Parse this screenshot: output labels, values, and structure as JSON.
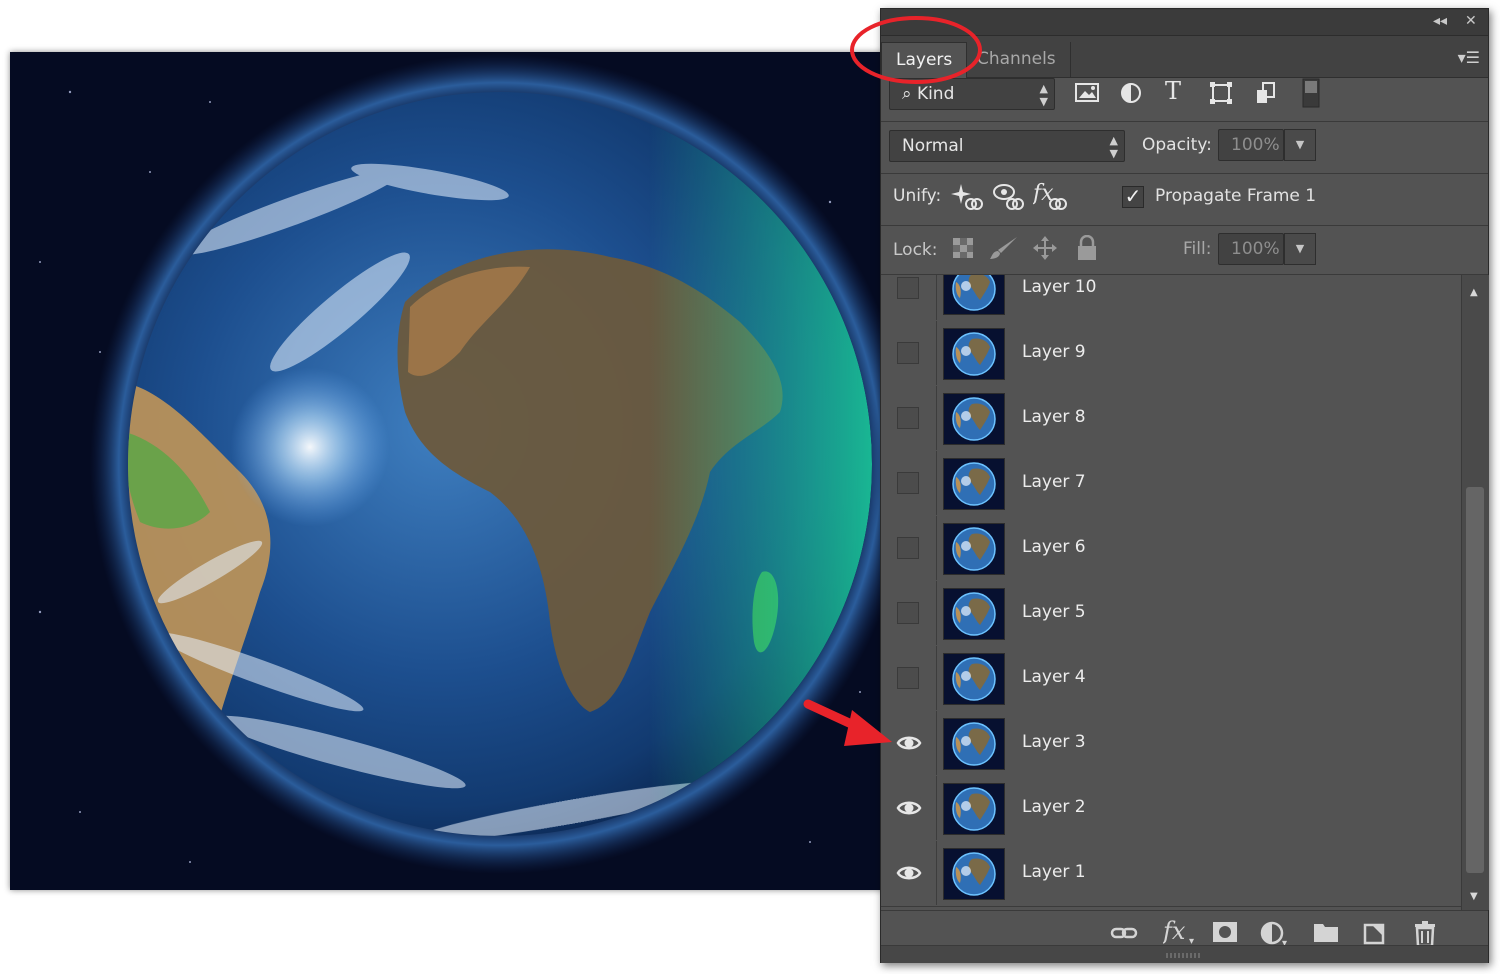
{
  "panel": {
    "tabs": [
      {
        "label": "Layers",
        "active": true
      },
      {
        "label": "Channels",
        "active": false
      }
    ],
    "collapse_icon": "double-chevron-left-icon",
    "close_icon": "close-icon",
    "menu_icon": "panel-menu-icon"
  },
  "filter": {
    "kind_label": "Kind",
    "filter_icons": [
      "image-filter-icon",
      "adjustment-filter-icon",
      "type-filter-icon",
      "shape-filter-icon",
      "smart-object-filter-icon"
    ]
  },
  "blend": {
    "mode": "Normal",
    "opacity_label": "Opacity:",
    "opacity_value": "100%"
  },
  "unify": {
    "label": "Unify:",
    "propagate_label": "Propagate Frame 1",
    "propagate_checked": true
  },
  "lock": {
    "label": "Lock:",
    "fill_label": "Fill:",
    "fill_value": "100%"
  },
  "layers": [
    {
      "name": "Layer 10",
      "visible": false
    },
    {
      "name": "Layer 9",
      "visible": false
    },
    {
      "name": "Layer 8",
      "visible": false
    },
    {
      "name": "Layer 7",
      "visible": false
    },
    {
      "name": "Layer 6",
      "visible": false
    },
    {
      "name": "Layer 5",
      "visible": false
    },
    {
      "name": "Layer 4",
      "visible": false
    },
    {
      "name": "Layer 3",
      "visible": true
    },
    {
      "name": "Layer 2",
      "visible": true
    },
    {
      "name": "Layer 1",
      "visible": true
    }
  ],
  "colors": {
    "panel_bg": "#535353",
    "annotation_red": "#e8232a",
    "space_bg": "#050b22"
  }
}
